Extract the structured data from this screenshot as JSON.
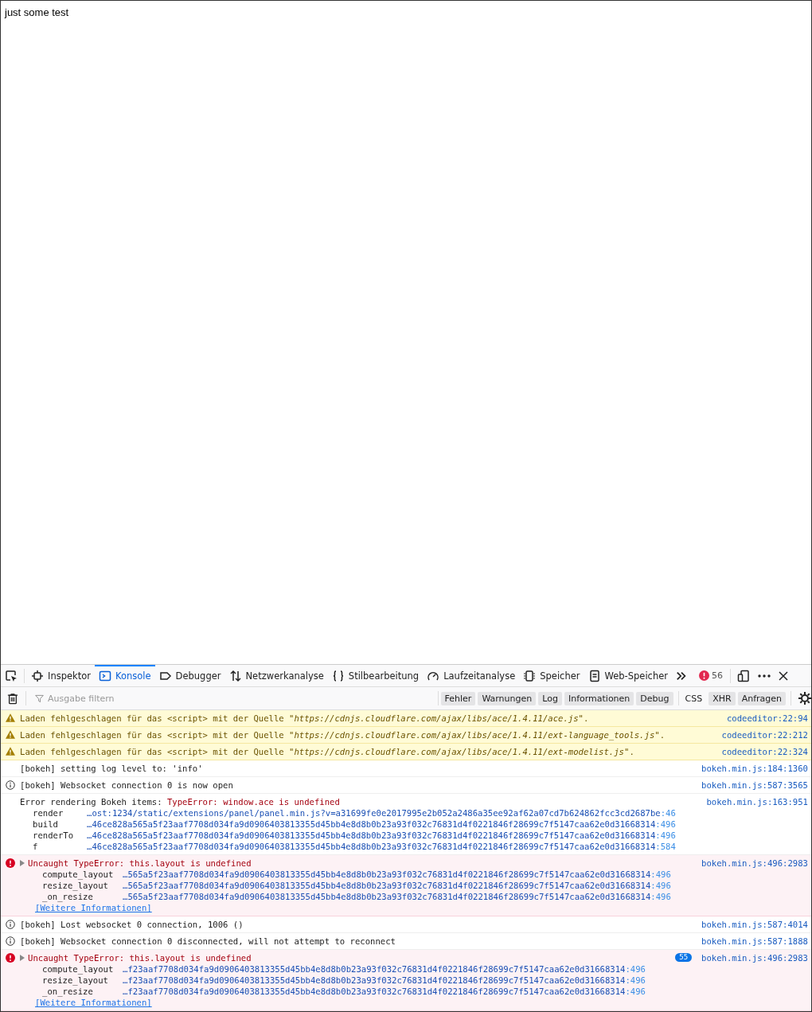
{
  "page": {
    "text": "just some test"
  },
  "devtools": {
    "tabs": [
      {
        "label": "Inspektor",
        "selected": false
      },
      {
        "label": "Konsole",
        "selected": true
      },
      {
        "label": "Debugger",
        "selected": false
      },
      {
        "label": "Netzwerkanalyse",
        "selected": false
      },
      {
        "label": "Stilbearbeitung",
        "selected": false
      },
      {
        "label": "Laufzeitanalyse",
        "selected": false
      },
      {
        "label": "Speicher",
        "selected": false
      },
      {
        "label": "Web-Speicher",
        "selected": false
      }
    ],
    "error_count": "56",
    "filter": {
      "placeholder": "Ausgabe filtern"
    },
    "level_filters": [
      {
        "label": "Fehler",
        "selected": true
      },
      {
        "label": "Warnungen",
        "selected": true
      },
      {
        "label": "Log",
        "selected": true
      },
      {
        "label": "Informationen",
        "selected": true
      },
      {
        "label": "Debug",
        "selected": true
      }
    ],
    "type_filters": [
      {
        "label": "CSS",
        "selected": false
      },
      {
        "label": "XHR",
        "selected": true
      },
      {
        "label": "Anfragen",
        "selected": true
      }
    ],
    "messages": [
      {
        "kind": "warning",
        "text": "Laden fehlgeschlagen für das <script> mit der Quelle \"*https://cdnjs.cloudflare.com/ajax/libs/ace/1.4.11/ace.js*\".",
        "source": "codeeditor:22:94"
      },
      {
        "kind": "warning",
        "text": "Laden fehlgeschlagen für das <script> mit der Quelle \"*https://cdnjs.cloudflare.com/ajax/libs/ace/1.4.11/ext-language_tools.js*\".",
        "source": "codeeditor:22:212"
      },
      {
        "kind": "warning",
        "text": "Laden fehlgeschlagen für das <script> mit der Quelle \"*https://cdnjs.cloudflare.com/ajax/libs/ace/1.4.11/ext-modelist.js*\".",
        "source": "codeeditor:22:324"
      },
      {
        "kind": "log",
        "text": "[bokeh] setting log level to: 'info'",
        "source": "bokeh.min.js:184:1360"
      },
      {
        "kind": "info",
        "text": "[bokeh] Websocket connection 0 is now open",
        "source": "bokeh.min.js:587:3565"
      },
      {
        "kind": "log",
        "text": "Error rendering Bokeh items: ",
        "error_text": "TypeError: window.ace is undefined",
        "source": "bokeh.min.js:163:951",
        "stack": [
          {
            "function": "render",
            "location": "…ost:1234/static/extensions/panel/panel.min.js?v=a31699fe0e2017995e2b052a2486a35ee92af62a07cd7b624862fcc3cd2687be",
            "line": ":46"
          },
          {
            "function": "build",
            "location": "…46ce828a565a5f23aaf7708d034fa9d0906403813355d45bb4e8d8b0b23a93f032c76831d4f0221846f28699c7f5147caa62e0d31668314",
            "line": ":496"
          },
          {
            "function": "renderTo",
            "location": "…46ce828a565a5f23aaf7708d034fa9d0906403813355d45bb4e8d8b0b23a93f032c76831d4f0221846f28699c7f5147caa62e0d31668314",
            "line": ":496"
          },
          {
            "function": "f",
            "location": "…46ce828a565a5f23aaf7708d034fa9d0906403813355d45bb4e8d8b0b23a93f032c76831d4f0221846f28699c7f5147caa62e0d31668314",
            "line": ":584"
          }
        ]
      },
      {
        "kind": "error",
        "text": "Uncaught TypeError: this.layout is undefined",
        "source": "bokeh.min.js:496:2983",
        "stack": [
          {
            "function": "compute_layout",
            "location": "…565a5f23aaf7708d034fa9d0906403813355d45bb4e8d8b0b23a93f032c76831d4f0221846f28699c7f5147caa62e0d31668314",
            "line": ":496"
          },
          {
            "function": "resize_layout",
            "location": "…565a5f23aaf7708d034fa9d0906403813355d45bb4e8d8b0b23a93f032c76831d4f0221846f28699c7f5147caa62e0d31668314",
            "line": ":496"
          },
          {
            "function": "_on_resize",
            "location": "…565a5f23aaf7708d034fa9d0906403813355d45bb4e8d8b0b23a93f032c76831d4f0221846f28699c7f5147caa62e0d31668314",
            "line": ":496"
          }
        ],
        "more_info": "[Weitere Informationen]"
      },
      {
        "kind": "info",
        "text": "[bokeh] Lost websocket 0 connection, 1006 ()",
        "source": "bokeh.min.js:587:4014"
      },
      {
        "kind": "info",
        "text": "[bokeh] Websocket connection 0 disconnected, will not attempt to reconnect",
        "source": "bokeh.min.js:587:1888"
      },
      {
        "kind": "error",
        "text": "Uncaught TypeError: this.layout is undefined",
        "repeat_count": "55",
        "source": "bokeh.min.js:496:2983",
        "stack": [
          {
            "function": "compute_layout",
            "location": "…f23aaf7708d034fa9d0906403813355d45bb4e8d8b0b23a93f032c76831d4f0221846f28699c7f5147caa62e0d31668314",
            "line": ":496"
          },
          {
            "function": "resize_layout",
            "location": "…f23aaf7708d034fa9d0906403813355d45bb4e8d8b0b23a93f032c76831d4f0221846f28699c7f5147caa62e0d31668314",
            "line": ":496"
          },
          {
            "function": "_on_resize",
            "location": "…f23aaf7708d034fa9d0906403813355d45bb4e8d8b0b23a93f032c76831d4f0221846f28699c7f5147caa62e0d31668314",
            "line": ":496"
          }
        ],
        "more_info": "[Weitere Informationen]"
      }
    ]
  }
}
